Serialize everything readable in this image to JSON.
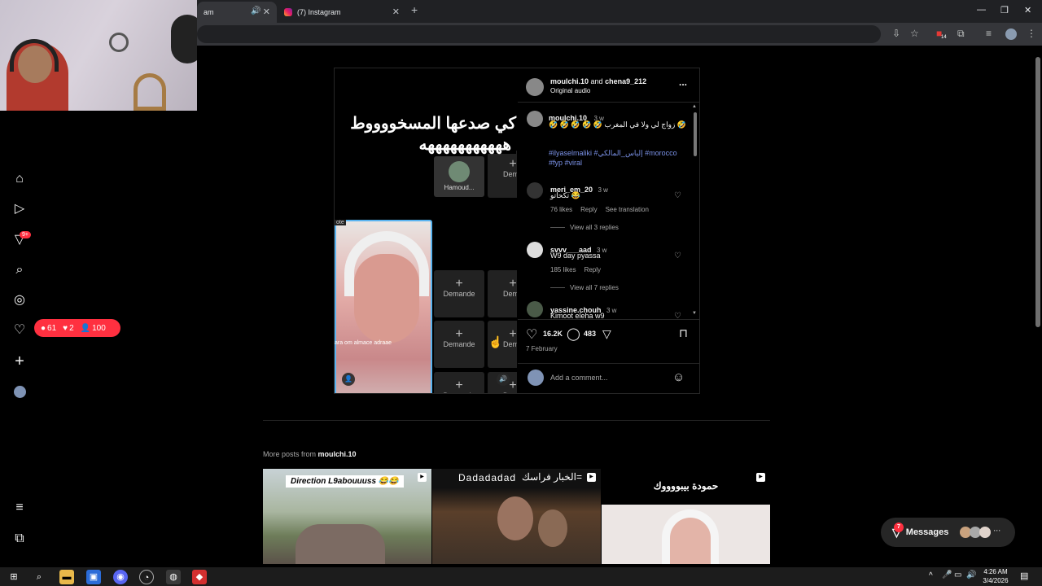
{
  "browser": {
    "tabs": [
      {
        "title": "am",
        "active": true
      },
      {
        "title": "(7) Instagram",
        "active": false
      }
    ],
    "extension_badge": "14"
  },
  "sidebar": {
    "notifications_badge": "9+",
    "activity": {
      "comments": "61",
      "likes": "2",
      "follows": "100"
    }
  },
  "post": {
    "header_user1": "moulchi.10",
    "header_and": "and",
    "header_user2": "chena9_212",
    "audio": "Original audio",
    "more": "...",
    "video": {
      "caption_line1": "كي صدعها المسخووووط",
      "caption_line2": "هههههههههههه",
      "face_caption": "ara om almace adraae",
      "note_label": "ote",
      "hamoud_label": "Hamoud...",
      "demande_label": "Demande",
      "demande_short": "Dema"
    },
    "caption_comment": {
      "user": "moulchi.10",
      "time": "3 w",
      "text": "🤣 🤣 🤣 🤣 🤣 زواج لي ولا في المغرب 🤣",
      "hashtags": "#ilyaselmaliki #إلياس_المالكي #morocco #fyp #viral"
    },
    "comments": [
      {
        "user": "meri_em_20",
        "time": "3 w",
        "text": "تكحاتو 😂",
        "likes": "76 likes",
        "reply": "Reply",
        "translate": "See translation",
        "view_replies": "View all 3 replies"
      },
      {
        "user": "svvv___aad",
        "time": "3 w",
        "text": "W9 day pyassa",
        "likes": "185 likes",
        "reply": "Reply",
        "view_replies": "View all 7 replies"
      },
      {
        "user": "yassine.chouh",
        "time": "3 w",
        "text": "Kimoot eleha w9"
      }
    ],
    "actions": {
      "likes": "16.2K",
      "comments": "483"
    },
    "date": "7 February",
    "comment_placeholder": "Add a comment..."
  },
  "more_posts": {
    "prefix": "More posts from",
    "user": "moulchi.10",
    "thumbs": [
      {
        "caption": "Direction L9abouuuss 😂😂"
      },
      {
        "caption": "Dadadadad"
      },
      {
        "caption": "حمودة بيبووووك"
      }
    ],
    "thumb2_arabic": "الخبار فراسك="
  },
  "messages": {
    "label": "Messages",
    "badge": "7"
  },
  "taskbar": {
    "time": "4:26 AM",
    "date": "3/4/2026"
  },
  "colors": {
    "accent_red": "#ff3040",
    "link_blue": "#7b92e8",
    "background": "#000000"
  }
}
